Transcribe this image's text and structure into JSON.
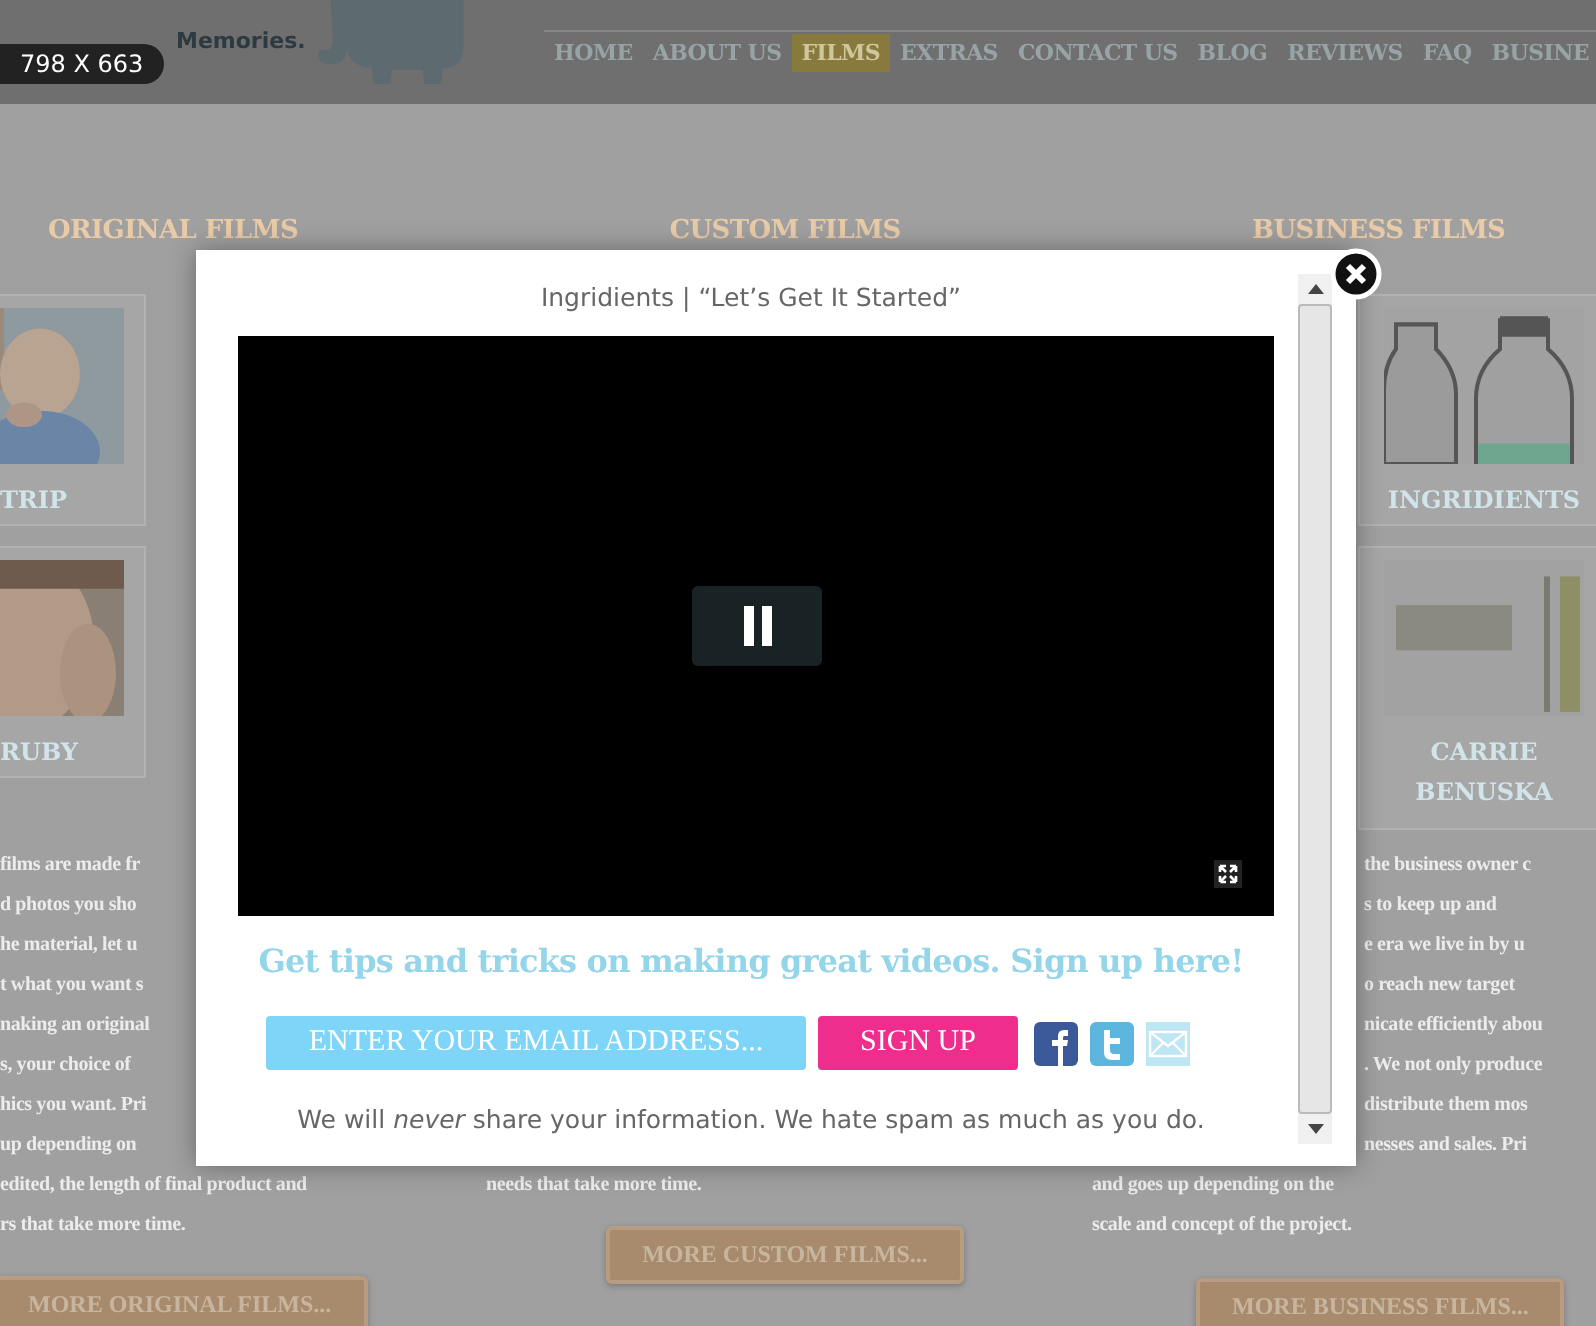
{
  "badge": "798 X 663",
  "header": {
    "tagline": "Memories.",
    "nav": [
      {
        "label": "HOME",
        "selected": false
      },
      {
        "label": "ABOUT US",
        "selected": false
      },
      {
        "label": "FILMS",
        "selected": true
      },
      {
        "label": "EXTRAS",
        "selected": false
      },
      {
        "label": "CONTACT US",
        "selected": false
      },
      {
        "label": "BLOG",
        "selected": false
      },
      {
        "label": "REVIEWS",
        "selected": false
      },
      {
        "label": "FAQ",
        "selected": false
      },
      {
        "label": "BUSINE",
        "selected": false
      }
    ]
  },
  "columns": [
    {
      "heading": "ORIGINAL FILMS",
      "cards": [
        "TRIP",
        "RUBY"
      ],
      "lines": [
        "films are made fr",
        "d photos you sho",
        "he material, let u",
        "t what you want s",
        "naking an original",
        "s, your choice of",
        "hics you want. Pri",
        "up depending on",
        "edited, the length of final product and",
        "rs that take more time."
      ],
      "button": "MORE ORIGINAL FILMS..."
    },
    {
      "heading": "CUSTOM FILMS",
      "lines": [
        "needs that take more time."
      ],
      "button": "MORE CUSTOM FILMS..."
    },
    {
      "heading": "BUSINESS FILMS",
      "cards": [
        "INGRIDIENTS",
        "CARRIE BENUSKA"
      ],
      "lines": [
        "the business owner c",
        "s to keep up and",
        "e era we live in by u",
        "o reach new target",
        "nicate efficiently abou",
        ". We not only produce",
        " distribute them mos",
        "nesses and sales. Pri",
        "and goes up depending on the",
        "scale and concept of the project."
      ],
      "button": "MORE BUSINESS FILMS..."
    }
  ],
  "modal": {
    "title": "Ingridients | “Let’s Get It Started”",
    "headline": "Get tips and tricks on making great videos. Sign up here!",
    "email": {
      "placeholder": "ENTER YOUR EMAIL ADDRESS..."
    },
    "submit": "SIGN UP",
    "note": "We will *never* share your information. We hate spam as much as you do."
  }
}
